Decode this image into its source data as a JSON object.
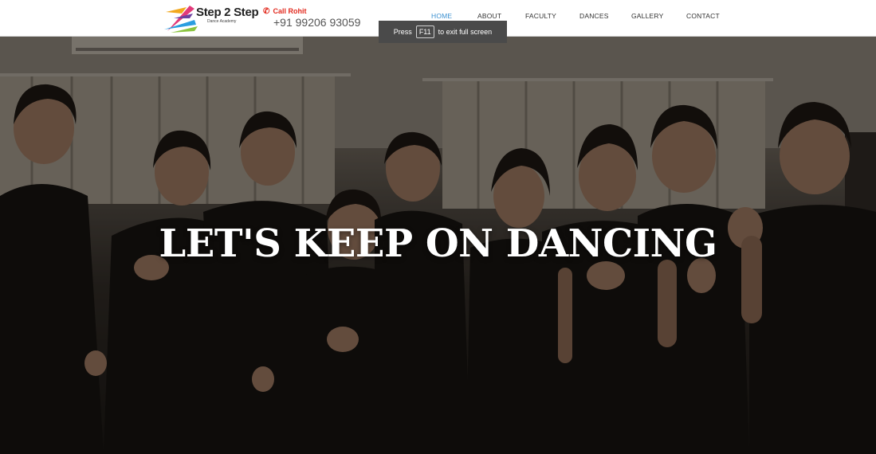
{
  "brand": {
    "name": "Step 2 Step",
    "tagline": "Dance Academy",
    "colors": {
      "accent_red": "#e22a1e",
      "nav_active": "#3a8fd0"
    }
  },
  "contact": {
    "icon": "phone-icon",
    "label": "Call Rohit",
    "number": "+91 99206 93059"
  },
  "nav": {
    "items": [
      {
        "label": "HOME",
        "active": true
      },
      {
        "label": "ABOUT",
        "active": false
      },
      {
        "label": "FACULTY",
        "active": false
      },
      {
        "label": "DANCES",
        "active": false
      },
      {
        "label": "GALLERY",
        "active": false
      },
      {
        "label": "CONTACT",
        "active": false
      }
    ]
  },
  "fullscreen_toast": {
    "prefix": "Press",
    "key": "F11",
    "suffix": "to exit full screen"
  },
  "hero": {
    "headline": "LET'S KEEP ON DANCING"
  }
}
